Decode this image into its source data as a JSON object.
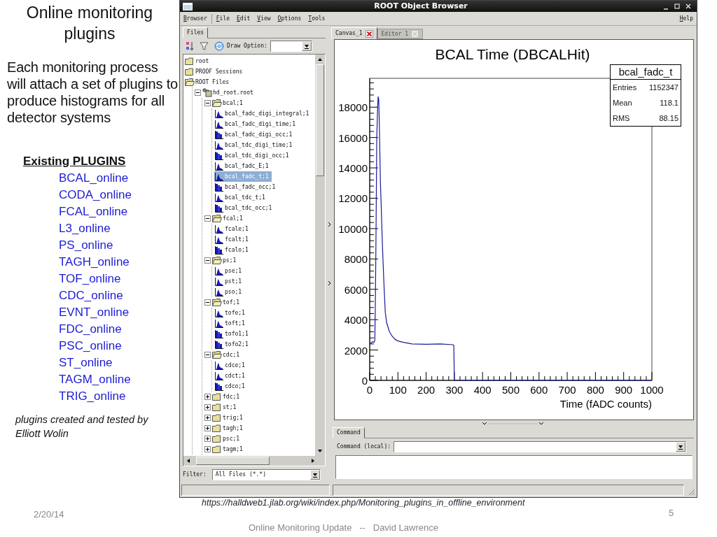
{
  "slide": {
    "title": "Online monitoring plugins",
    "intro": "Each monitoring process will attach a set of plugins to produce histograms for all detector systems",
    "plugins_heading": "Existing PLUGINS",
    "plugins": [
      "BCAL_online",
      "CODA_online",
      "FCAL_online",
      "L3_online",
      "PS_online",
      "TAGH_online",
      "TOF_online",
      "CDC_online",
      "EVNT_online",
      "FDC_online",
      "PSC_online",
      "ST_online",
      "TAGM_online",
      "TRIG_online"
    ],
    "credit": "plugins created and tested by Elliott Wolin",
    "url": "https://halldweb1.jlab.org/wiki/index.php/Monitoring_plugins_in_offline_environment",
    "date": "2/20/14",
    "page_number": "5",
    "footer": "Online Monitoring Update   --   David Lawrence"
  },
  "window": {
    "title": "ROOT Object Browser",
    "menu": [
      {
        "label": "Browser"
      },
      {
        "label": "File"
      },
      {
        "label": "Edit"
      },
      {
        "label": "View"
      },
      {
        "label": "Options"
      },
      {
        "label": "Tools"
      }
    ],
    "help": "Help",
    "left_tabs": [
      {
        "label": "Files",
        "selected": true
      }
    ],
    "draw_option_label": "Draw Option:",
    "tree": [
      {
        "label": "root",
        "kind": "folder",
        "selected": false
      },
      {
        "label": "PROOF Sessions",
        "kind": "folder",
        "selected": false
      },
      {
        "label": "ROOT Files",
        "kind": "folder-open",
        "selected": false,
        "children": [
          {
            "label": "hd_root.root",
            "kind": "file",
            "selected": false,
            "expanded": true,
            "children": [
              {
                "label": "bcal;1",
                "kind": "folder-open",
                "selected": false,
                "expanded": true,
                "children": [
                  {
                    "label": "bcal_fadc_digi_integral;1",
                    "kind": "hist",
                    "selected": false
                  },
                  {
                    "label": "bcal_fadc_digi_time;1",
                    "kind": "hist",
                    "selected": false
                  },
                  {
                    "label": "bcal_fadc_digi_occ;1",
                    "kind": "bars",
                    "selected": false
                  },
                  {
                    "label": "bcal_tdc_digi_time;1",
                    "kind": "hist",
                    "selected": false
                  },
                  {
                    "label": "bcal_tdc_digi_occ;1",
                    "kind": "bars",
                    "selected": false
                  },
                  {
                    "label": "bcal_fadc_E;1",
                    "kind": "hist",
                    "selected": false
                  },
                  {
                    "label": "bcal_fadc_t;1",
                    "kind": "hist",
                    "selected": true
                  },
                  {
                    "label": "bcal_fadc_occ;1",
                    "kind": "bars",
                    "selected": false
                  },
                  {
                    "label": "bcal_tdc_t;1",
                    "kind": "hist",
                    "selected": false
                  },
                  {
                    "label": "bcal_tdc_occ;1",
                    "kind": "bars",
                    "selected": false
                  }
                ]
              },
              {
                "label": "fcal;1",
                "kind": "folder-open",
                "selected": false,
                "expanded": true,
                "children": [
                  {
                    "label": "fcale;1",
                    "kind": "hist",
                    "selected": false
                  },
                  {
                    "label": "fcalt;1",
                    "kind": "hist",
                    "selected": false
                  },
                  {
                    "label": "fcalo;1",
                    "kind": "bars",
                    "selected": false
                  }
                ]
              },
              {
                "label": "ps;1",
                "kind": "folder-open",
                "selected": false,
                "expanded": true,
                "children": [
                  {
                    "label": "pse;1",
                    "kind": "hist",
                    "selected": false
                  },
                  {
                    "label": "pst;1",
                    "kind": "hist",
                    "selected": false
                  },
                  {
                    "label": "pso;1",
                    "kind": "hist",
                    "selected": false
                  }
                ]
              },
              {
                "label": "tof;1",
                "kind": "folder-open",
                "selected": false,
                "expanded": true,
                "children": [
                  {
                    "label": "tofe;1",
                    "kind": "hist",
                    "selected": false
                  },
                  {
                    "label": "toft;1",
                    "kind": "hist",
                    "selected": false
                  },
                  {
                    "label": "tofo1;1",
                    "kind": "bars",
                    "selected": false
                  },
                  {
                    "label": "tofo2;1",
                    "kind": "bars",
                    "selected": false
                  }
                ]
              },
              {
                "label": "cdc;1",
                "kind": "folder-open",
                "selected": false,
                "expanded": true,
                "children": [
                  {
                    "label": "cdce;1",
                    "kind": "hist",
                    "selected": false
                  },
                  {
                    "label": "cdct;1",
                    "kind": "hist",
                    "selected": false
                  },
                  {
                    "label": "cdco;1",
                    "kind": "bars",
                    "selected": false
                  }
                ]
              },
              {
                "label": "fdc;1",
                "kind": "folder",
                "selected": false,
                "expanded": false
              },
              {
                "label": "st;1",
                "kind": "folder",
                "selected": false,
                "expanded": false
              },
              {
                "label": "trig;1",
                "kind": "folder",
                "selected": false,
                "expanded": false
              },
              {
                "label": "tagh;1",
                "kind": "folder",
                "selected": false,
                "expanded": false
              },
              {
                "label": "psc;1",
                "kind": "folder",
                "selected": false,
                "expanded": false
              },
              {
                "label": "tagm;1",
                "kind": "folder",
                "selected": false,
                "expanded": false
              }
            ]
          }
        ]
      }
    ],
    "filter_label": "Filter:",
    "filter_value": "All Files (*.*)",
    "right_tabs": [
      {
        "label": "Canvas_1",
        "selected": true,
        "close_enabled": true
      },
      {
        "label": "Editor 1",
        "selected": false,
        "close_enabled": false
      }
    ],
    "canvas": {
      "stats": {
        "rows": [
          {
            "label": "Entries",
            "value": "1152347"
          },
          {
            "label": "Mean",
            "value": "118.1"
          },
          {
            "label": "RMS",
            "value": "88.15"
          }
        ]
      },
      "chart_data": {
        "type": "line",
        "title": "BCAL Time (DBCALHit)",
        "xlabel": "Time (fADC counts)",
        "xlim": [
          0,
          1000
        ],
        "ylim": [
          0,
          19900
        ],
        "xticks": [
          0,
          100,
          200,
          300,
          400,
          500,
          600,
          700,
          800,
          900,
          1000
        ],
        "yticks": [
          0,
          2000,
          4000,
          6000,
          8000,
          10000,
          12000,
          14000,
          16000,
          18000
        ],
        "x": [
          0,
          5,
          10,
          15,
          18,
          20,
          22,
          25,
          28,
          30,
          32,
          34,
          36,
          38,
          40,
          45,
          50,
          55,
          60,
          70,
          80,
          90,
          100,
          120,
          150,
          200,
          250,
          295,
          298,
          300,
          1000
        ],
        "series": [
          {
            "name": "bcal_fadc_t",
            "color": "#1a1a9a",
            "values": [
              2500,
              2450,
              2550,
              2500,
              2600,
              5200,
              9000,
              16000,
              18000,
              18700,
              18500,
              17000,
              15000,
              13000,
              12000,
              9000,
              6500,
              4500,
              3800,
              3200,
              2900,
              2700,
              2600,
              2500,
              2400,
              2380,
              2400,
              2350,
              2300,
              0,
              0
            ]
          }
        ]
      }
    },
    "command_tab": "Command",
    "command_label": "Command (local):"
  }
}
